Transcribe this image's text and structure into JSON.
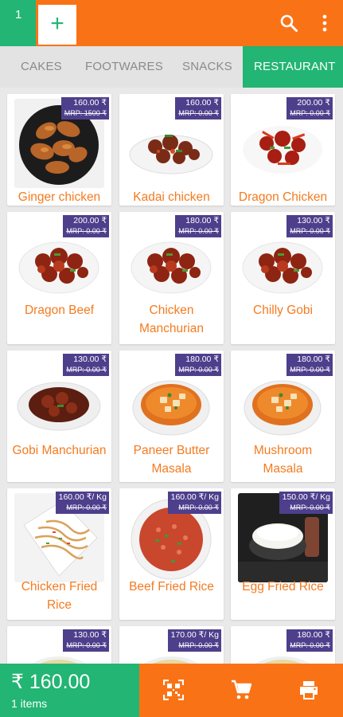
{
  "topbar": {
    "tab_count": "1",
    "add_label": "+"
  },
  "categories": [
    {
      "label": "CAKES",
      "active": false
    },
    {
      "label": "FOOTWARES",
      "active": false
    },
    {
      "label": "SNACKS",
      "active": false
    },
    {
      "label": "RESTAURANT",
      "active": true
    }
  ],
  "colors": {
    "primary_orange": "#f97316",
    "accent_green": "#22b573",
    "badge_purple": "#4e3f8c",
    "item_name": "#f47b20"
  },
  "products": [
    {
      "name": "Ginger chicken",
      "price": "160.00 ₹",
      "mrp": "MRP: 1500 ₹",
      "image": "fried-chicken"
    },
    {
      "name": "Kadai chicken",
      "price": "160.00 ₹",
      "mrp": "MRP: 0.00 ₹",
      "image": "curry-dish"
    },
    {
      "name": "Dragon Chicken",
      "price": "200.00 ₹",
      "mrp": "MRP: 0.00 ₹",
      "image": "chilli-dish"
    },
    {
      "name": "Dragon Beef",
      "price": "200.00 ₹",
      "mrp": "MRP: 0.00 ₹",
      "image": "red-dish"
    },
    {
      "name": "Chicken Manchurian",
      "price": "180.00 ₹",
      "mrp": "MRP: 0.00 ₹",
      "image": "red-dish"
    },
    {
      "name": "Chilly Gobi",
      "price": "130.00 ₹",
      "mrp": "MRP: 0.00 ₹",
      "image": "red-dish"
    },
    {
      "name": "Gobi Manchurian",
      "price": "130.00 ₹",
      "mrp": "MRP: 0.00 ₹",
      "image": "gravy-dish"
    },
    {
      "name": "Paneer Butter Masala",
      "price": "180.00 ₹",
      "mrp": "MRP: 0.00 ₹",
      "image": "orange-gravy"
    },
    {
      "name": "Mushroom Masala",
      "price": "180.00 ₹",
      "mrp": "MRP: 0.00 ₹",
      "image": "orange-gravy"
    },
    {
      "name": "Chicken Fried Rice",
      "price": "160.00 ₹/ Kg",
      "mrp": "MRP: 0.00 ₹",
      "image": "noodles"
    },
    {
      "name": "Beef Fried Rice",
      "price": "160.00 ₹/ Kg",
      "mrp": "MRP: 0.00 ₹",
      "image": "red-rice"
    },
    {
      "name": "Egg Fried Rice",
      "price": "150.00 ₹/ Kg",
      "mrp": "MRP: 0.00 ₹",
      "image": "white-rice"
    },
    {
      "name": "",
      "price": "130.00 ₹",
      "mrp": "MRP: 0.00 ₹",
      "image": "fried-rice"
    },
    {
      "name": "",
      "price": "170.00 ₹/ Kg",
      "mrp": "MRP: 0.00 ₹",
      "image": "fried-rice"
    },
    {
      "name": "",
      "price": "180.00 ₹",
      "mrp": "MRP: 0.00 ₹",
      "image": "fried-rice"
    }
  ],
  "cart": {
    "total": "₹ 160.00",
    "items": "1 items"
  },
  "bottom_actions": [
    "qr-scan-icon",
    "cart-icon",
    "print-icon"
  ]
}
